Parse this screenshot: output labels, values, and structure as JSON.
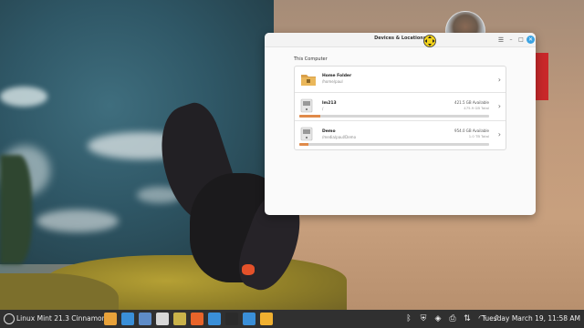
{
  "window": {
    "title": "Devices & Locations",
    "section_label": "This Computer"
  },
  "locations": [
    {
      "name": "Home Folder",
      "path": "/home/paul",
      "type": "folder"
    },
    {
      "name": "lm213",
      "path": "/",
      "available": "421.5 GB Available",
      "total": "475.9 GB Total",
      "usage": 0.11,
      "type": "drive"
    },
    {
      "name": "Demo",
      "path": "/media/paul/Demo",
      "available": "954.0 GB Available",
      "total": "1.0 TB Total",
      "usage": 0.05,
      "type": "drive"
    }
  ],
  "panel": {
    "menu_label": "Linux Mint 21.3 Cinnamon",
    "clock": "Tuesday March 19, 11:58 AM",
    "launchers": [
      {
        "icon": "folder-icon",
        "color": "#e8a23a"
      },
      {
        "icon": "camera-icon",
        "color": "#3a8fd8"
      },
      {
        "icon": "screenshot-icon",
        "color": "#5e8cc8"
      },
      {
        "icon": "app-icon",
        "color": "#d8d8d8"
      },
      {
        "icon": "hat-icon",
        "color": "#c9b24a"
      },
      {
        "icon": "firefox-icon",
        "color": "#e8642a"
      },
      {
        "icon": "settings-icon",
        "color": "#3a8fd8"
      },
      {
        "icon": "terminal-icon",
        "color": "#2b2b2b"
      },
      {
        "icon": "camera-icon",
        "color": "#3a8fd8"
      },
      {
        "icon": "files-icon",
        "color": "#f0b030"
      }
    ],
    "tray": [
      "bluetooth-icon",
      "shield-icon",
      "update-icon",
      "printer-icon",
      "network-icon",
      "wifi-icon",
      "volume-icon"
    ]
  }
}
